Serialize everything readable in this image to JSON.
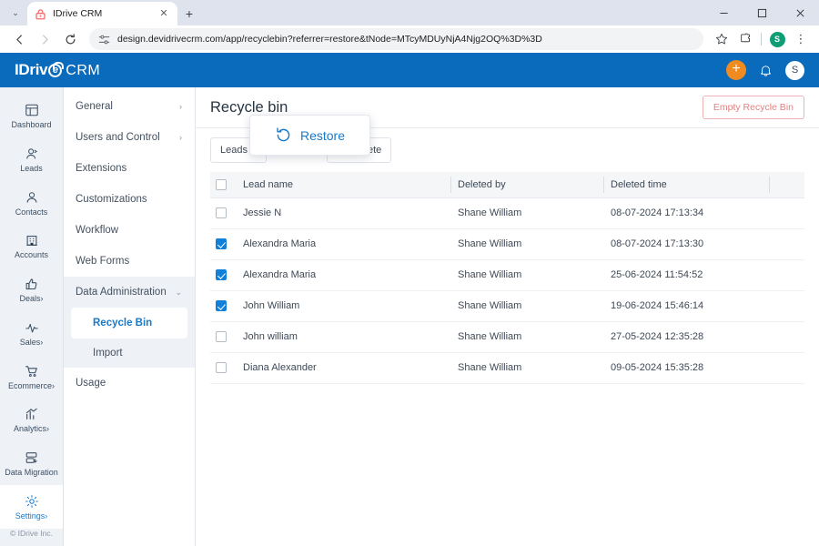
{
  "browser": {
    "tab": {
      "title": "IDrive CRM",
      "favicon": "lock-icon",
      "close": "✕"
    },
    "tab_list_caret": "⌄",
    "new_tab": "+",
    "window_controls": {
      "minimize": "–",
      "maximize": "□",
      "close": "✕"
    },
    "nav": {
      "back": "←",
      "forward": "→",
      "reload": "⟳"
    },
    "omnibox": {
      "site_settings_icon": "tune-icon",
      "url": "design.devidrivecrm.com/app/recyclebin?referrer=restore&tNode=MTcyMDUyNjA4Njg2OQ%3D%3D"
    },
    "toolbar_icons": {
      "bookmark": "star-icon",
      "extensions": "puzzle-icon",
      "menu": "⋮"
    },
    "profile": {
      "initial": "S",
      "color": "#0f9d76"
    }
  },
  "app_header": {
    "logo": {
      "brand": "IDriv",
      "mark": "e",
      "product": "CRM"
    },
    "add_label": "+",
    "bell": "bell-icon",
    "avatar_initial": "S",
    "bg": "#0a6bbd",
    "add_color": "#ef8b21"
  },
  "rail": {
    "items": [
      {
        "label": "Dashboard",
        "icon": "dashboard-icon",
        "chevron": "",
        "active": false
      },
      {
        "label": "Leads",
        "icon": "leads-icon",
        "chevron": "",
        "active": false
      },
      {
        "label": "Contacts",
        "icon": "contacts-icon",
        "chevron": "",
        "active": false
      },
      {
        "label": "Accounts",
        "icon": "accounts-icon",
        "chevron": "",
        "active": false
      },
      {
        "label": "Deals",
        "icon": "deals-icon",
        "chevron": "›",
        "active": false
      },
      {
        "label": "Sales",
        "icon": "sales-icon",
        "chevron": "›",
        "active": false
      },
      {
        "label": "Ecommerce",
        "icon": "ecommerce-icon",
        "chevron": "›",
        "active": false
      },
      {
        "label": "Analytics",
        "icon": "analytics-icon",
        "chevron": "›",
        "active": false
      },
      {
        "label": "Data Migration",
        "icon": "data-migration-icon",
        "chevron": "",
        "active": false
      },
      {
        "label": "Settings",
        "icon": "gear-icon",
        "chevron": "›",
        "active": true
      }
    ],
    "footer": "© IDrive Inc."
  },
  "subnav": {
    "items": [
      {
        "label": "General",
        "chevron": "›"
      },
      {
        "label": "Users and Control",
        "chevron": "›"
      },
      {
        "label": "Extensions",
        "chevron": ""
      },
      {
        "label": "Customizations",
        "chevron": ""
      },
      {
        "label": "Workflow",
        "chevron": ""
      },
      {
        "label": "Web Forms",
        "chevron": ""
      }
    ],
    "group": {
      "label": "Data Administration",
      "chevron": "⌄",
      "children": [
        {
          "label": "Recycle Bin",
          "active": true
        },
        {
          "label": "Import",
          "active": false
        }
      ]
    },
    "trailing": [
      {
        "label": "Usage",
        "chevron": ""
      }
    ]
  },
  "main": {
    "title": "Recycle bin",
    "empty_button": "Empty Recycle Bin",
    "module_filter": {
      "value": "Leads",
      "caret": "▾"
    },
    "delete_button": "Delete",
    "restore_popover": {
      "label": "Restore",
      "icon": "restore-arrow-icon"
    },
    "table": {
      "select_all_checked": false,
      "columns": [
        "Lead name",
        "Deleted by",
        "Deleted time",
        ""
      ],
      "rows": [
        {
          "checked": false,
          "name": "Jessie N",
          "deleted_by": "Shane William",
          "deleted_time": "08-07-2024 17:13:34"
        },
        {
          "checked": true,
          "name": "Alexandra Maria",
          "deleted_by": "Shane William",
          "deleted_time": "08-07-2024 17:13:30"
        },
        {
          "checked": true,
          "name": "Alexandra Maria",
          "deleted_by": "Shane William",
          "deleted_time": "25-06-2024 11:54:52"
        },
        {
          "checked": true,
          "name": "John William",
          "deleted_by": "Shane William",
          "deleted_time": "19-06-2024 15:46:14"
        },
        {
          "checked": false,
          "name": "John william",
          "deleted_by": "Shane William",
          "deleted_time": "27-05-2024 12:35:28"
        },
        {
          "checked": false,
          "name": "Diana Alexander",
          "deleted_by": "Shane William",
          "deleted_time": "09-05-2024 15:35:28"
        }
      ]
    }
  }
}
